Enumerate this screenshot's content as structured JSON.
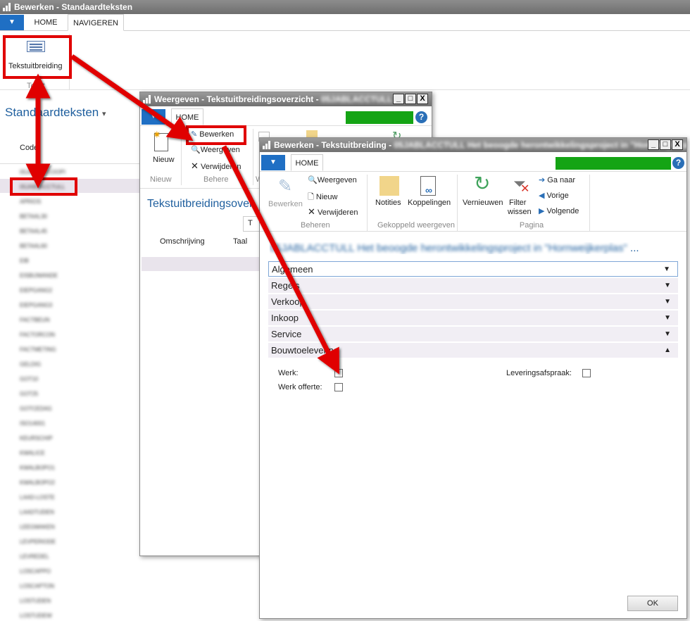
{
  "main": {
    "title": "Bewerken - Standaardteksten",
    "menu_icon": "dropdown-arrow-icon",
    "tabs": [
      "HOME",
      "NAVIGEREN"
    ],
    "ribbon_button": "Tekstuitbreiding",
    "ribbon_group": "Tekst",
    "list_title": "Standaardteksten",
    "list_title_arrow": "▾",
    "column_header": "Code",
    "rows": [
      "05JABLACCOOPI",
      "05JABLACCTULL",
      "APRIOS",
      "BETAAL30",
      "BETAAL45",
      "BETAAL60",
      "EIB",
      "EISBIJWANDE",
      "EIEPGANG2",
      "EIEPGANG3",
      "FACTBEUN",
      "FACTORCON",
      "FACTMETING",
      "GELDIG",
      "GOT10",
      "GOT25",
      "GOTCEDAG",
      "ISO14001",
      "KEURSCHIP",
      "KWALICE",
      "KWALBOPO1",
      "KWALBOPO2",
      "LAAD-LOSTE",
      "LAADTIJDEN",
      "LEEGMAKEN",
      "LEVPERIODE",
      "LEVREDEL",
      "LOSCAPPO",
      "LOSCAPTON",
      "LOSTIJDEN",
      "LOSTIJDEW"
    ],
    "selected_row_index": 1
  },
  "win2": {
    "title": "Weergeven - Tekstuitbreidingsoverzicht -",
    "title_blurred": "05JABLACCTULL",
    "tab": "HOME",
    "btn_new": "Nieuw",
    "btn_edit": "Bewerken",
    "btn_view": "Weergeven",
    "btn_delete": "Verwijderen",
    "grp_new": "Nieuw",
    "grp_manage": "Behere",
    "grp_view": "W",
    "page_title": "Tekstuitbreidingsover",
    "filter_tab": "T",
    "col_desc": "Omschrijving",
    "col_lang": "Taal",
    "help": "?",
    "win_buttons": [
      "_",
      "□",
      "X"
    ]
  },
  "win3": {
    "title": "Bewerken - Tekstuitbreiding -",
    "title_blurred": "05JABLACCTULL Het beoogde herontwikkelingsproject in \"Hornweijkerplas\"",
    "tab": "HOME",
    "help": "?",
    "win_buttons": [
      "_",
      "□",
      "X"
    ],
    "ribbon": {
      "edit": "Bewerken",
      "view": "Weergeven",
      "new": "Nieuw",
      "delete": "Verwijderen",
      "notes": "Notities",
      "links": "Koppelingen",
      "refresh": "Vernieuwen",
      "filter": "Filter",
      "filter2": "wissen",
      "goto": "Ga naar",
      "prev": "Vorige",
      "next": "Volgende",
      "grp_manage": "Beheren",
      "grp_linked": "Gekoppeld weergeven",
      "grp_page": "Pagina"
    },
    "heading": "05JABLACCTULL Het beoogde herontwikkelingsproject in \"Hornweijkerplas\"",
    "heading_more": "...",
    "fasttabs": [
      "Algemeen",
      "Regels",
      "Verkoop",
      "Inkoop",
      "Service",
      "Bouwtoelevering"
    ],
    "fields": {
      "werk": "Werk:",
      "werk_offerte": "Werk offerte:",
      "leveringsafspraak": "Leveringsafspraak:"
    },
    "ok": "OK"
  },
  "colors": {
    "accent": "#1f6fc4",
    "highlight": "#e00000",
    "progress": "#14a414"
  }
}
